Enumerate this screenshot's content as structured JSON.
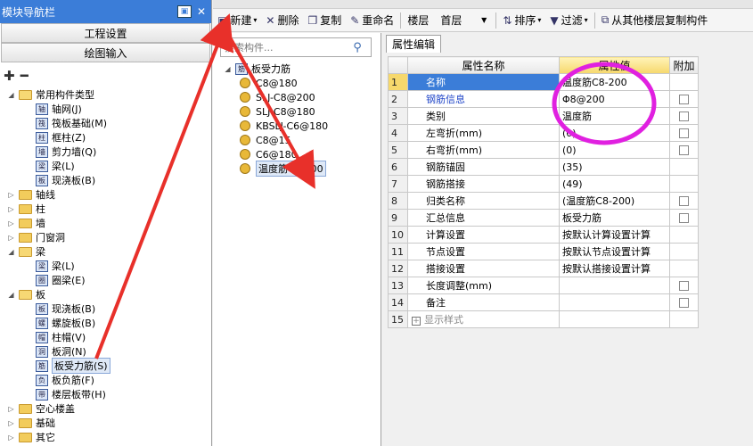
{
  "nav": {
    "title": "模块导航栏",
    "sections": [
      "工程设置",
      "绘图输入"
    ],
    "toolbar_icons": [
      "add-icon",
      "minus-icon"
    ],
    "tree": [
      {
        "depth": 0,
        "exp": "◢",
        "type": "folder",
        "label": "常用构件类型"
      },
      {
        "depth": 1,
        "icon": "轴",
        "label": "轴网(J)"
      },
      {
        "depth": 1,
        "icon": "筏",
        "label": "筏板基础(M)"
      },
      {
        "depth": 1,
        "icon": "柱",
        "label": "框柱(Z)"
      },
      {
        "depth": 1,
        "icon": "墙",
        "label": "剪力墙(Q)"
      },
      {
        "depth": 1,
        "icon": "梁",
        "label": "梁(L)"
      },
      {
        "depth": 1,
        "icon": "板",
        "label": "现浇板(B)"
      },
      {
        "depth": 0,
        "exp": "▷",
        "type": "folder",
        "label": "轴线"
      },
      {
        "depth": 0,
        "exp": "▷",
        "type": "folder",
        "label": "柱"
      },
      {
        "depth": 0,
        "exp": "▷",
        "type": "folder",
        "label": "墙"
      },
      {
        "depth": 0,
        "exp": "▷",
        "type": "folder",
        "label": "门窗洞"
      },
      {
        "depth": 0,
        "exp": "◢",
        "type": "folder",
        "label": "梁"
      },
      {
        "depth": 1,
        "icon": "梁",
        "label": "梁(L)"
      },
      {
        "depth": 1,
        "icon": "圈",
        "label": "圈梁(E)"
      },
      {
        "depth": 0,
        "exp": "◢",
        "type": "folder",
        "label": "板"
      },
      {
        "depth": 1,
        "icon": "板",
        "label": "现浇板(B)"
      },
      {
        "depth": 1,
        "icon": "螺",
        "label": "螺旋板(B)"
      },
      {
        "depth": 1,
        "icon": "帽",
        "label": "柱帽(V)"
      },
      {
        "depth": 1,
        "icon": "洞",
        "label": "板洞(N)"
      },
      {
        "depth": 1,
        "icon": "筋",
        "label": "板受力筋(S)",
        "selected": true
      },
      {
        "depth": 1,
        "icon": "负",
        "label": "板负筋(F)"
      },
      {
        "depth": 1,
        "icon": "带",
        "label": "楼层板带(H)"
      },
      {
        "depth": 0,
        "exp": "▷",
        "type": "folder",
        "label": "空心楼盖"
      },
      {
        "depth": 0,
        "exp": "▷",
        "type": "folder",
        "label": "基础"
      },
      {
        "depth": 0,
        "exp": "▷",
        "type": "folder",
        "label": "其它"
      }
    ]
  },
  "toolbar": {
    "new_label": "新建",
    "delete_label": "删除",
    "copy_label": "复制",
    "rename_label": "重命名",
    "floor_label": "楼层",
    "floor_value": "首层",
    "sort_label": "排序",
    "filter_label": "过滤",
    "copy_from_floor_label": "从其他楼层复制构件"
  },
  "component_panel": {
    "search_placeholder": "搜索构件...",
    "root_label": "板受力筋",
    "items": [
      "C8@180",
      "SLJ-C8@200",
      "SLJ-C8@180",
      "KBSLJ-C6@180",
      "C8@15",
      "C6@180",
      "温度筋C8-200"
    ],
    "selected_index": 6
  },
  "properties": {
    "tab_label": "属性编辑",
    "headers": {
      "name": "属性名称",
      "value": "属性值",
      "attach": "附加"
    },
    "rows": [
      {
        "num": "1",
        "name": "名称",
        "value": "温度筋C8-200",
        "checkbox": false,
        "blue": false,
        "selected": true
      },
      {
        "num": "2",
        "name": "钢筋信息",
        "value": "Φ8@200",
        "checkbox": true,
        "blue": true
      },
      {
        "num": "3",
        "name": "类别",
        "value": "温度筋",
        "checkbox": true,
        "blue": false
      },
      {
        "num": "4",
        "name": "左弯折(mm)",
        "value": "(0)",
        "checkbox": true,
        "blue": false
      },
      {
        "num": "5",
        "name": "右弯折(mm)",
        "value": "(0)",
        "checkbox": true,
        "blue": false
      },
      {
        "num": "6",
        "name": "钢筋锚固",
        "value": "(35)",
        "checkbox": false,
        "blue": false
      },
      {
        "num": "7",
        "name": "钢筋搭接",
        "value": "(49)",
        "checkbox": false,
        "blue": false
      },
      {
        "num": "8",
        "name": "归类名称",
        "value": "(温度筋C8-200)",
        "checkbox": true,
        "blue": false
      },
      {
        "num": "9",
        "name": "汇总信息",
        "value": "板受力筋",
        "checkbox": true,
        "blue": false
      },
      {
        "num": "10",
        "name": "计算设置",
        "value": "按默认计算设置计算",
        "checkbox": false,
        "blue": false
      },
      {
        "num": "11",
        "name": "节点设置",
        "value": "按默认节点设置计算",
        "checkbox": false,
        "blue": false
      },
      {
        "num": "12",
        "name": "搭接设置",
        "value": "按默认搭接设置计算",
        "checkbox": false,
        "blue": false
      },
      {
        "num": "13",
        "name": "长度调整(mm)",
        "value": "",
        "checkbox": true,
        "blue": false
      },
      {
        "num": "14",
        "name": "备注",
        "value": "",
        "checkbox": true,
        "blue": false
      },
      {
        "num": "15",
        "name": "显示样式",
        "value": "",
        "checkbox": false,
        "blue": false,
        "expandable": true
      }
    ]
  },
  "annotation_colors": {
    "arrow": "#e8302a",
    "circle": "#e020e0"
  }
}
